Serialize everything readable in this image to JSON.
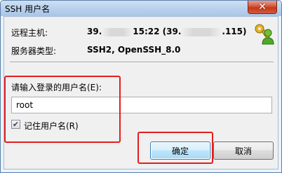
{
  "window": {
    "title": "SSH 用户名",
    "close_glyph": "✕"
  },
  "info": {
    "host_label": "远程主机:",
    "host_value_prefix": "39.",
    "host_value_mid": "15:22 (39.",
    "host_value_suffix": ".115)",
    "server_type_label": "服务器类型:",
    "server_type_value": "SSH2, OpenSSH_8.0",
    "icon": "keys-icon"
  },
  "form": {
    "prompt_label": "请输入登录的用户名(E):",
    "username_value": "root",
    "remember_checked": true,
    "remember_label": "记住用户名(R)"
  },
  "buttons": {
    "ok_label": "确定",
    "cancel_label": "取消"
  },
  "colors": {
    "highlight_red": "#e21e1e",
    "title_bar": "#b9d1ec",
    "close_button": "#c3381a"
  }
}
